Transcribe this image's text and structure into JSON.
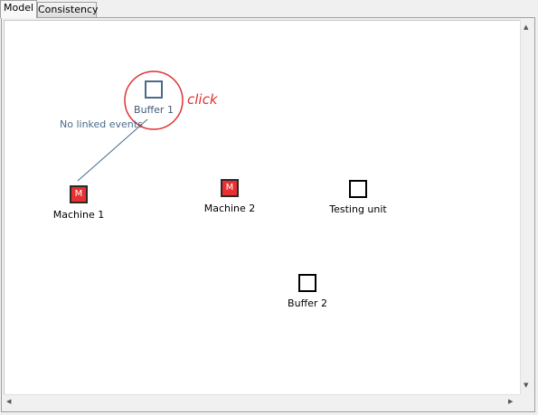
{
  "tabs": [
    {
      "label": "Model",
      "active": true
    },
    {
      "label": "Consistency",
      "active": false
    }
  ],
  "nodes": {
    "buffer1": {
      "label": "Buffer 1",
      "type": "buffer",
      "selected": true
    },
    "machine1": {
      "label": "Machine 1",
      "type": "machine",
      "glyph": "M"
    },
    "machine2": {
      "label": "Machine 2",
      "type": "machine",
      "glyph": "M"
    },
    "testing_unit": {
      "label": "Testing unit",
      "type": "buffer"
    },
    "buffer2": {
      "label": "Buffer 2",
      "type": "buffer"
    }
  },
  "link_annotation": "No linked events",
  "hint_text": "click",
  "colors": {
    "machine_fill": "#e83030",
    "selection_circle": "#e03030",
    "link_line": "#4a6a8a"
  }
}
